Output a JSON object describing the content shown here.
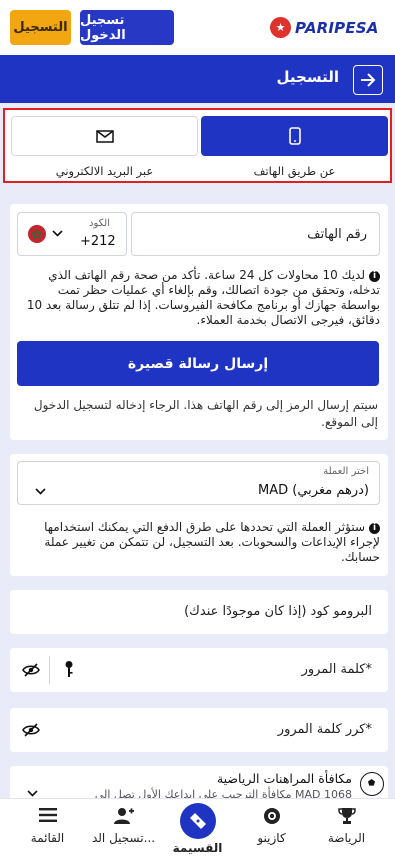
{
  "header": {
    "logo_text": "PARIPESA",
    "login_label": "تسجيل الدخول",
    "register_label": "التسجيل"
  },
  "titlebar": {
    "title": "التسجيل"
  },
  "methods": {
    "phone_label": "عن طريق الهاتف",
    "email_label": "عبر البريد الالكتروني"
  },
  "phone_card": {
    "phone_placeholder": "رقم الهاتف",
    "code_caption": "الكود",
    "code_value": "+212",
    "info_text": "لديك 10 محاولات كل 24 ساعة. تأكد من صحة رقم الهاتف الذي تدخله، وتحقق من جودة اتصالك، وقم بإلغاء أي عمليات حظر تمت بواسطة جهازك أو برنامج مكافحة الفيروسات. إذا لم تتلق رسالة بعد 10 دقائق، فيرجى الاتصال بخدمة العملاء.",
    "send_label": "إرسال رسالة قصيرة",
    "sms_note": "سيتم إرسال الرمز إلى رقم الهاتف هذا. الرجاء إدخاله لتسجيل الدخول إلى الموقع."
  },
  "currency_card": {
    "caption": "اختر العملة",
    "value": "MAD (درهم مغربي)",
    "info_text": "ستؤثر العملة التي تحددها على طرق الدفع التي يمكنك استخدامها لإجراء الإيداعات والسحوبات. بعد التسجيل، لن تتمكن من تغيير عملة حسابك."
  },
  "promo": {
    "placeholder": "البرومو كود (إذا كان موجودًا عندك)"
  },
  "password": {
    "placeholder": "كلمة المرور*"
  },
  "password_repeat": {
    "placeholder": "كرر كلمة المرور*"
  },
  "bonus": {
    "title": "مكافأة المراهنات الرياضية",
    "subtitle": "مكافأة الترحيب على إيداعك الأول تصل إلى MAD 1068"
  },
  "bottomnav": {
    "menu": "القائمة",
    "register": "تسجيل الد...",
    "coupon": "القسيمة",
    "casino": "كازينو",
    "sports": "الرياضة"
  },
  "colors": {
    "primary": "#1f34c2",
    "accent": "#f2a712",
    "highlight_border": "#e02020"
  }
}
